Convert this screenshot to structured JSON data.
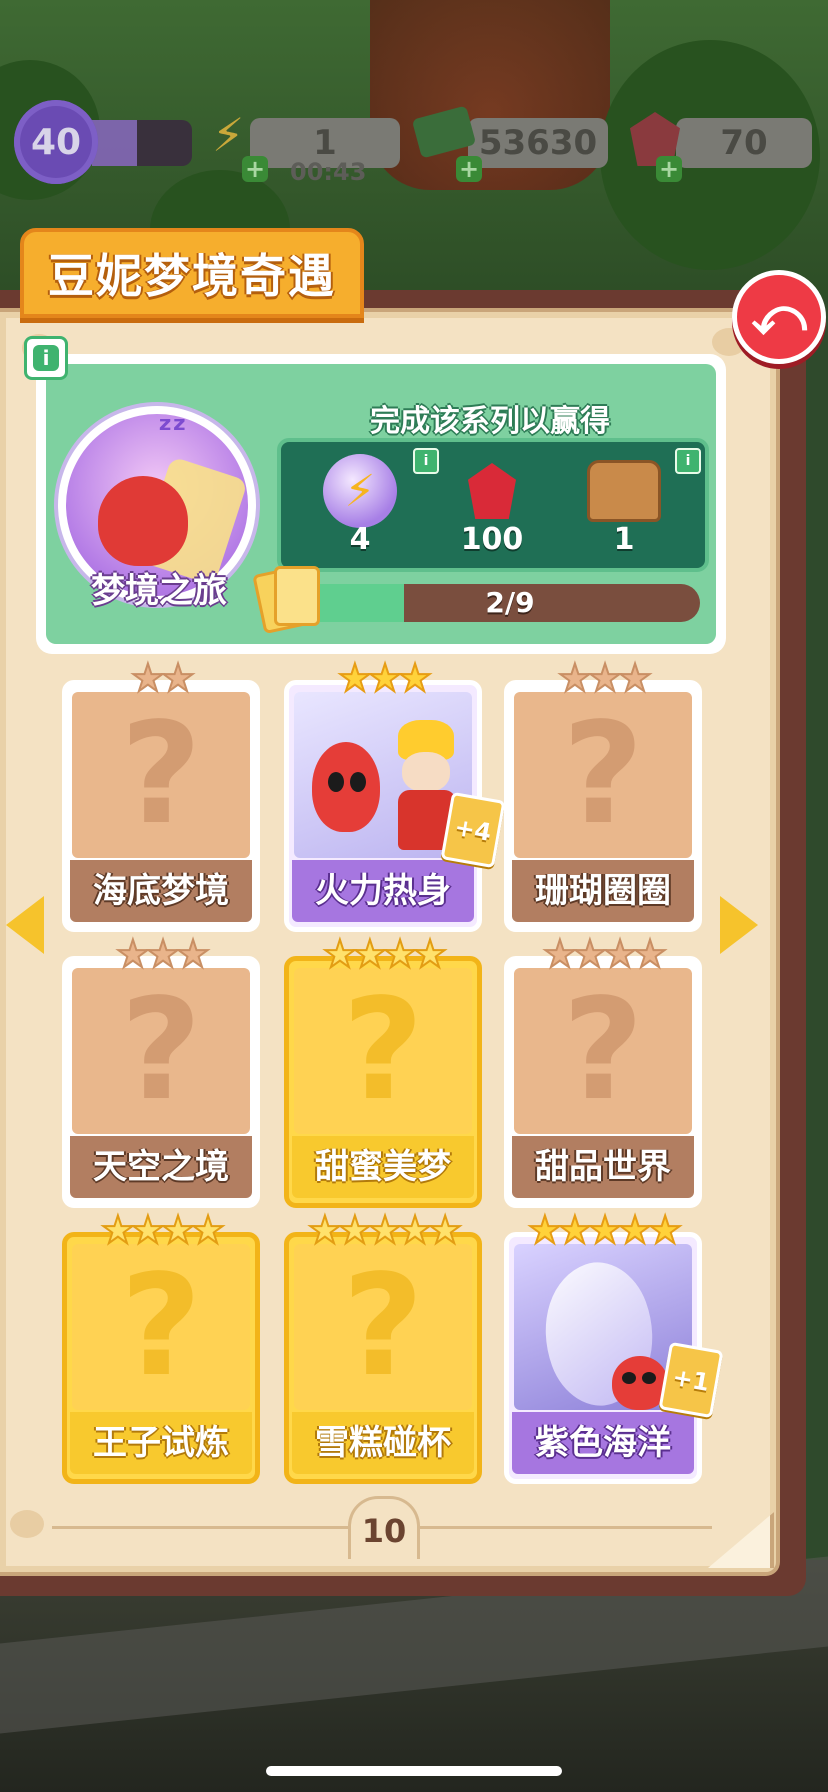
{
  "hud": {
    "level": "40",
    "energy": "1",
    "energy_timer": "00:43",
    "cash": "53630",
    "gems": "70",
    "plus": "+"
  },
  "title": "豆妮梦境奇遇",
  "back_button_icon": "arrow-left-icon",
  "info_icon": "i",
  "series": {
    "name": "梦境之旅",
    "reward_heading": "完成该系列以赢得",
    "rewards": [
      {
        "icon": "energy-orb-icon",
        "qty": "4",
        "has_info": true
      },
      {
        "icon": "ruby-icon",
        "qty": "100",
        "has_info": false
      },
      {
        "icon": "treasure-chest-icon",
        "qty": "1",
        "has_info": true
      }
    ],
    "progress_text": "2/9",
    "progress_fraction": 0.22
  },
  "cards": [
    {
      "label": "海底梦境",
      "stars": "★★",
      "state": "locked",
      "symbol": "?"
    },
    {
      "label": "火力热身",
      "stars": "★★★",
      "state": "collected",
      "dup": "+4"
    },
    {
      "label": "珊瑚圈圈",
      "stars": "★★★",
      "state": "locked",
      "symbol": "?"
    },
    {
      "label": "天空之境",
      "stars": "★★★",
      "state": "locked",
      "symbol": "?"
    },
    {
      "label": "甜蜜美梦",
      "stars": "★★★★",
      "state": "gold-locked",
      "symbol": "?"
    },
    {
      "label": "甜品世界",
      "stars": "★★★★",
      "state": "locked",
      "symbol": "?"
    },
    {
      "label": "王子试炼",
      "stars": "★★★★",
      "state": "gold-locked",
      "symbol": "?"
    },
    {
      "label": "雪糕碰杯",
      "stars": "★★★★★",
      "state": "gold-locked",
      "symbol": "?"
    },
    {
      "label": "紫色海洋",
      "stars": "★★★★★",
      "state": "collected",
      "dup": "+1"
    }
  ],
  "page_number": "10",
  "colors": {
    "title_tab": "#f6ae2d",
    "back_button": "#ee3a45",
    "reward_panel": "#7ed1a0",
    "progress_fill": "#5fcf8f",
    "card_locked": "#e9b78c",
    "card_gold": "#ffd253",
    "card_purple_label": "#a676e0"
  }
}
